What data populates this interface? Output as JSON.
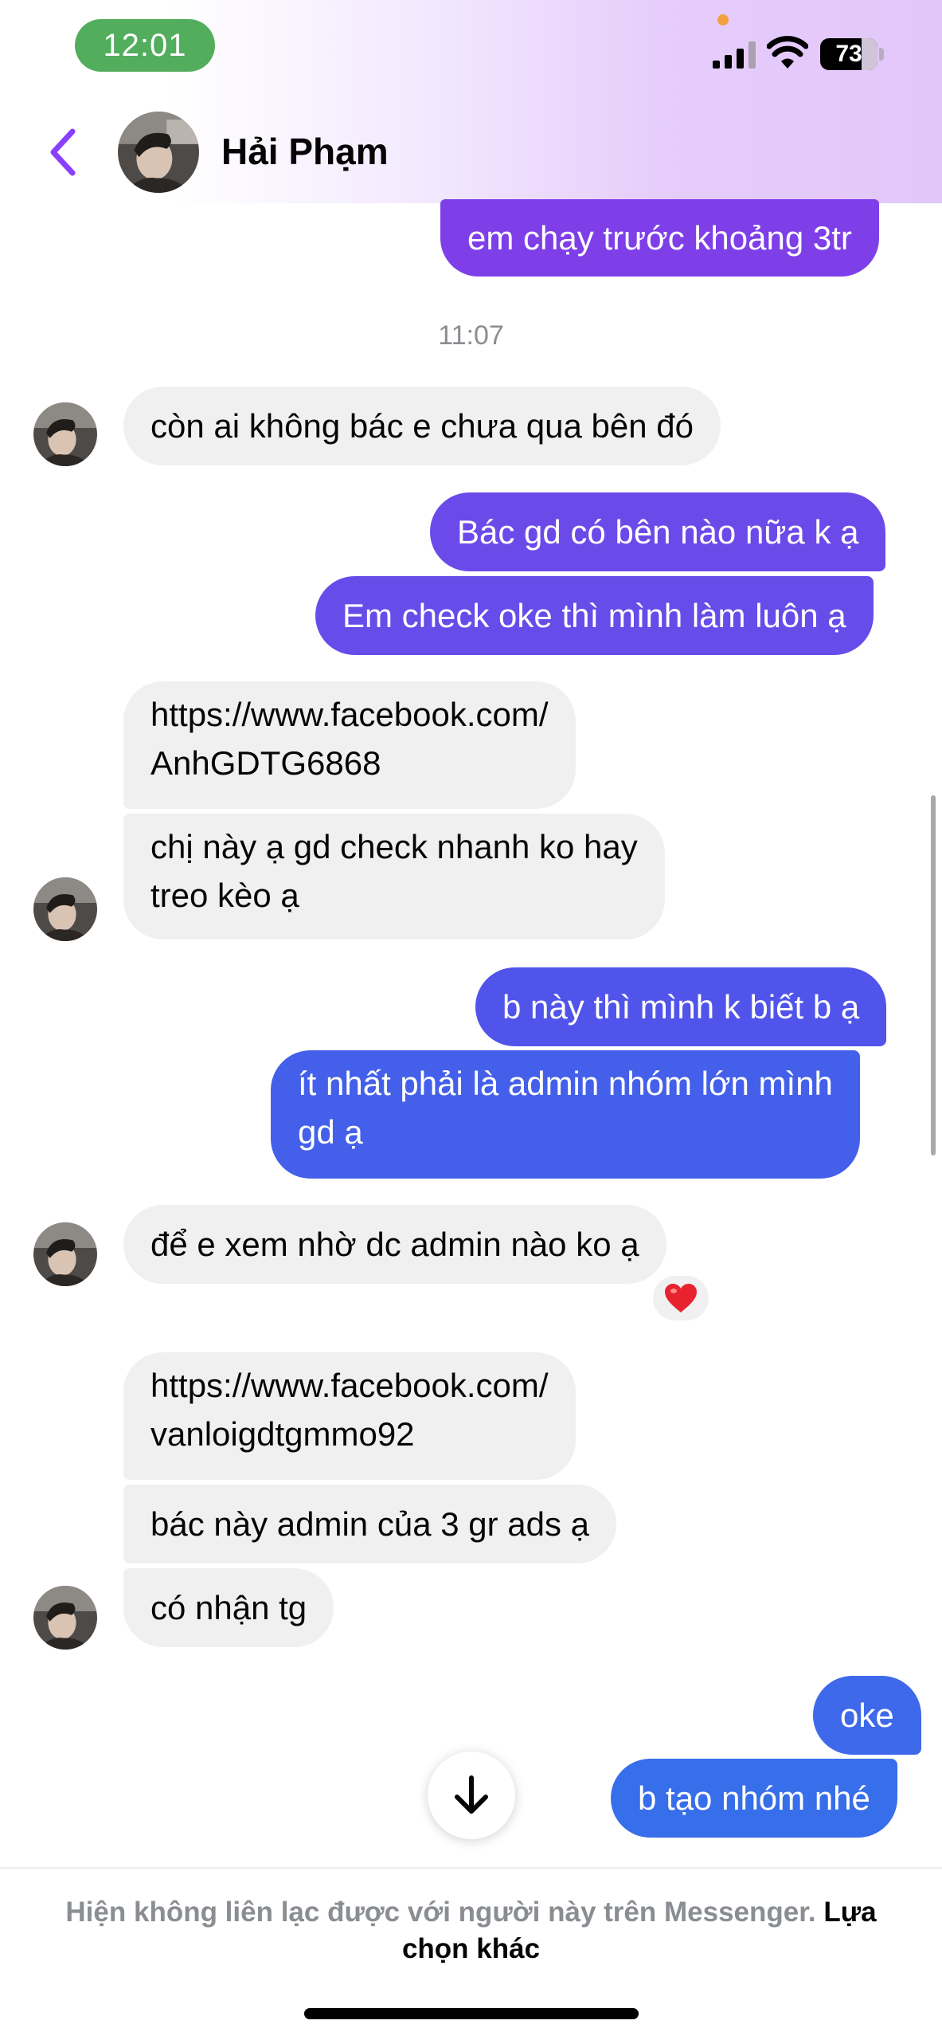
{
  "status_bar": {
    "time": "12:01",
    "battery": "73",
    "icons": [
      "signal-icon",
      "wifi-icon",
      "battery-icon"
    ]
  },
  "header": {
    "contact_name": "Hải Phạm",
    "back_icon": "chevron-left-icon"
  },
  "colors": {
    "outgoing_top": "#7e3fe8",
    "outgoing_bottom": "#4460ea",
    "incoming": "#f0f0f0",
    "accent": "#8a3ffc",
    "status_green": "#52ad5d"
  },
  "conversation": {
    "timestamp": "11:07",
    "messages": [
      {
        "from": "me",
        "text": "em chạy trước khoảng 3tr"
      },
      {
        "from": "contact",
        "text": "còn ai không bác e chưa qua bên đó"
      },
      {
        "from": "me",
        "text": "Bác gd có bên nào nữa k ạ"
      },
      {
        "from": "me",
        "text": "Em check oke thì mình làm luôn ạ"
      },
      {
        "from": "contact",
        "lines": [
          "https://www.facebook.com/",
          "AnhGDTG6868"
        ]
      },
      {
        "from": "contact",
        "lines": [
          "chị này ạ gd check nhanh ko hay",
          "treo kèo ạ"
        ]
      },
      {
        "from": "me",
        "text": "b này thì mình k biết b ạ"
      },
      {
        "from": "me",
        "lines": [
          "ít nhất phải là admin nhóm lớn mình",
          "gd ạ"
        ]
      },
      {
        "from": "contact",
        "text": "để e xem nhờ dc admin nào ko ạ",
        "reaction": "heart"
      },
      {
        "from": "contact",
        "lines": [
          "https://www.facebook.com/",
          "vanloigdtgmmo92"
        ]
      },
      {
        "from": "contact",
        "text": "bác này admin của 3 gr ads ạ"
      },
      {
        "from": "contact",
        "text": "có nhận tg"
      },
      {
        "from": "me",
        "text": "oke"
      },
      {
        "from": "me",
        "text": "b tạo nhóm nhé"
      }
    ]
  },
  "footer": {
    "notice": "Hiện không liên lạc được với người này trên Messenger.",
    "link": "Lựa chọn khác"
  }
}
